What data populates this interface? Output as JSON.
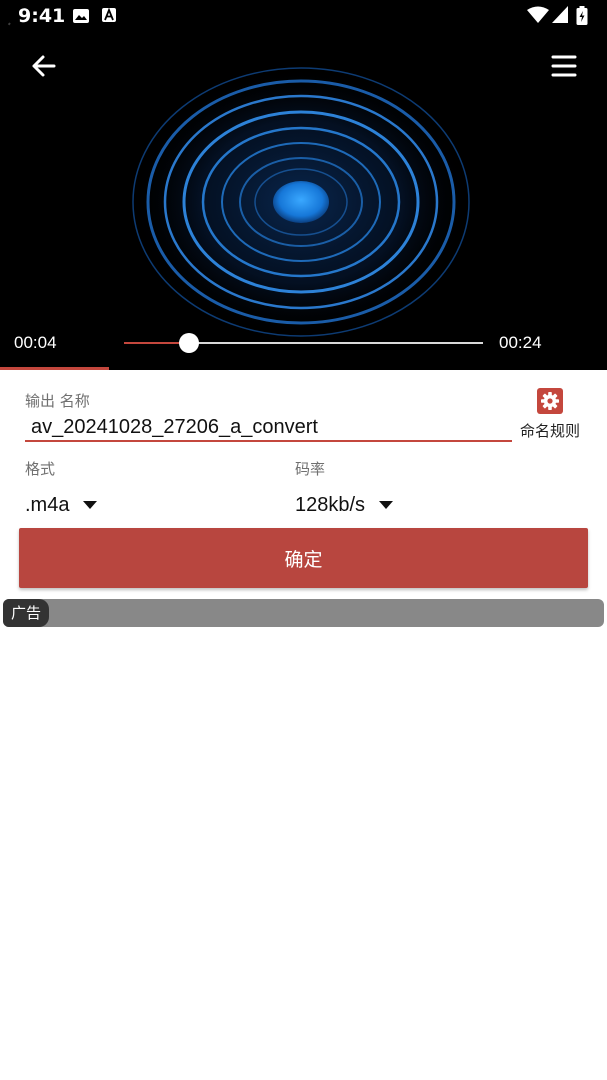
{
  "status_bar": {
    "time": "9:41",
    "left_icons": [
      "image-icon",
      "accessibility-a-icon"
    ],
    "right_icons": [
      "wifi-icon",
      "signal-icon",
      "battery-charging-icon"
    ]
  },
  "player": {
    "elapsed": "00:04",
    "total": "00:24",
    "progress_fraction": 0.18
  },
  "form": {
    "output_name_label": "输出 名称",
    "output_name_value": "av_20241028_27206_a_convert",
    "rule_label": "命名规则",
    "format_label": "格式",
    "format_value": ".m4a",
    "bitrate_label": "码率",
    "bitrate_value": "128kb/s",
    "confirm_label": "确定"
  },
  "ad": {
    "tag": "广告"
  },
  "colors": {
    "accent": "#c4473d",
    "button": "#b8463f",
    "visualizer": "#1e7fd6",
    "ad_bar": "#888888"
  }
}
